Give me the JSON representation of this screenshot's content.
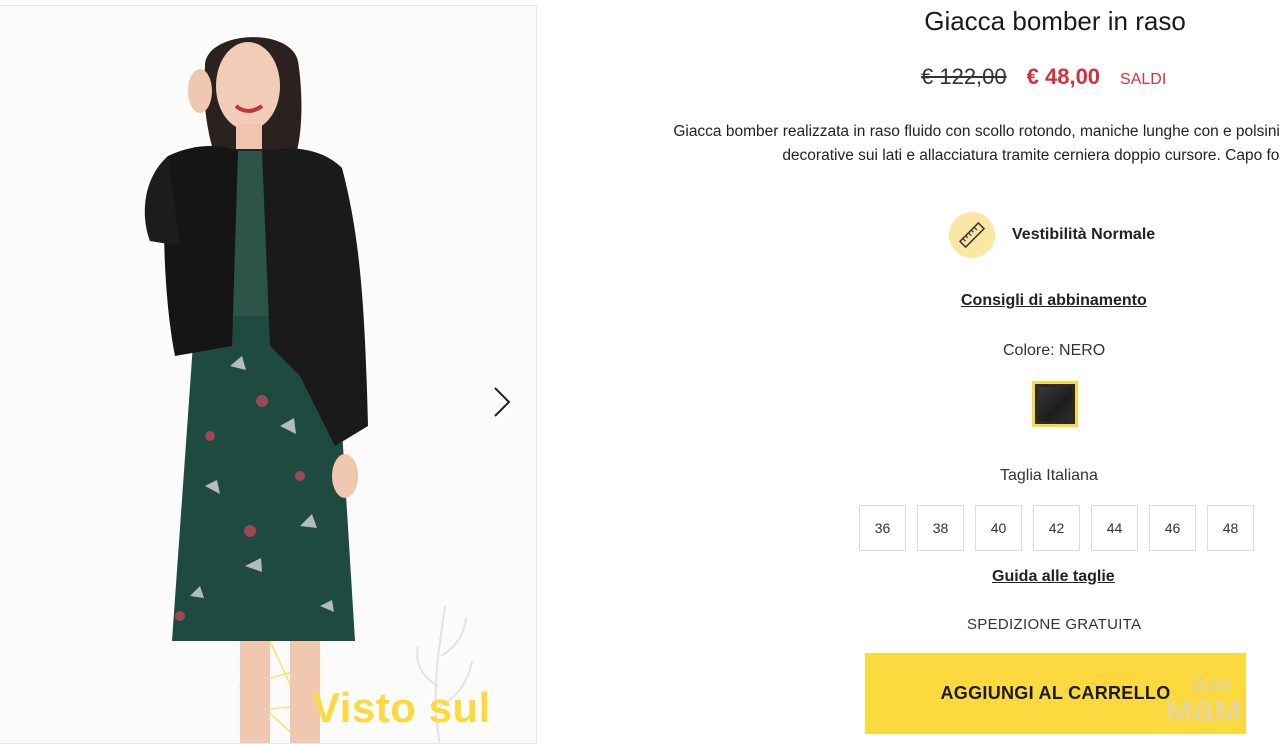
{
  "gallery": {
    "promo_text": "Visto sul",
    "next_icon": "chevron-right-icon"
  },
  "product": {
    "title": "Giacca bomber in raso",
    "old_price": "€ 122,00",
    "new_price": "€ 48,00",
    "sale_badge": "SALDI",
    "description": "Giacca bomber realizzata in raso fluido con scollo rotondo, maniche lunghe con e polsini, elastico sul fondo, zip decorative sui lati e allacciatura tramite cerniera doppio cursore. Capo foderato.",
    "fit_label": "Vestibilità Normale",
    "fit_icon": "ruler-icon",
    "advice_link": "Consigli di abbinamento",
    "color_label": "Colore: NERO",
    "swatch_color": "#2a2a2a",
    "size_label": "Taglia Italiana",
    "sizes": [
      "36",
      "38",
      "40",
      "42",
      "44",
      "46",
      "48"
    ],
    "size_guide_link": "Guida alle taglie",
    "shipping": "SPEDIZIONE GRATUITA",
    "cart_button": "AGGIUNGI AL CARRELLO"
  },
  "watermark": {
    "top": "для",
    "bottom": "мам"
  },
  "colors": {
    "accent_yellow": "#fcd93f",
    "sale_red": "#d0313b",
    "fit_circle": "#fbe6a3"
  }
}
